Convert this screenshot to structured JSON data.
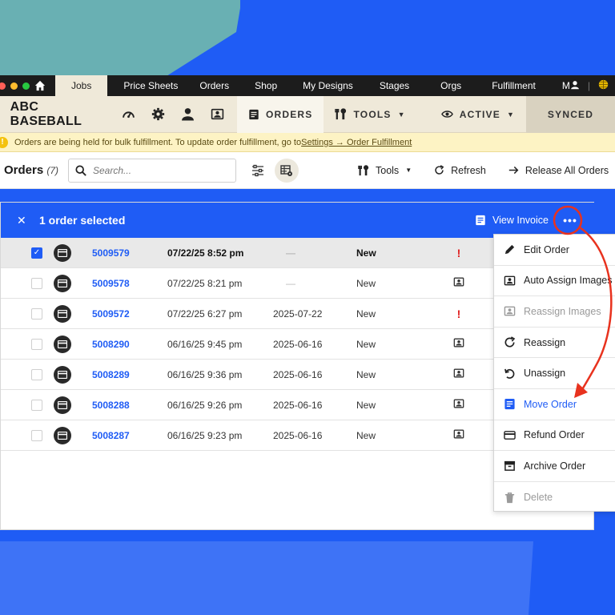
{
  "topnav": {
    "tabs": [
      "Jobs",
      "Price Sheets",
      "Orders",
      "Shop",
      "My Designs",
      "Stages",
      "Orgs",
      "Fulfillment",
      "M"
    ],
    "active_tab": "Jobs"
  },
  "orgbar": {
    "org_name": "ABC BASEBALL",
    "orders_label": "ORDERS",
    "tools_label": "TOOLS",
    "active_label": "ACTIVE",
    "synced_label": "SYNCED"
  },
  "notice": {
    "text": "Orders are being held for bulk fulfillment. To update order fulfillment, go to ",
    "link": "Settings → Order Fulfillment"
  },
  "toolbar": {
    "title": "Orders",
    "count": "(7)",
    "search_placeholder": "Search...",
    "tools_label": "Tools",
    "refresh_label": "Refresh",
    "release_label": "Release All Orders"
  },
  "selection": {
    "text": "1 order selected",
    "view_invoice": "View Invoice"
  },
  "orders": [
    {
      "number": "5009579",
      "date": "07/22/25 8:52 pm",
      "ship": "—",
      "status": "New",
      "flag": "!",
      "checked": true
    },
    {
      "number": "5009578",
      "date": "07/22/25 8:21 pm",
      "ship": "—",
      "status": "New",
      "flag": "img",
      "checked": false
    },
    {
      "number": "5009572",
      "date": "07/22/25 6:27 pm",
      "ship": "2025-07-22",
      "status": "New",
      "flag": "!",
      "checked": false
    },
    {
      "number": "5008290",
      "date": "06/16/25 9:45 pm",
      "ship": "2025-06-16",
      "status": "New",
      "flag": "img",
      "checked": false
    },
    {
      "number": "5008289",
      "date": "06/16/25 9:36 pm",
      "ship": "2025-06-16",
      "status": "New",
      "flag": "img",
      "checked": false
    },
    {
      "number": "5008288",
      "date": "06/16/25 9:26 pm",
      "ship": "2025-06-16",
      "status": "New",
      "flag": "img",
      "checked": false
    },
    {
      "number": "5008287",
      "date": "06/16/25 9:23 pm",
      "ship": "2025-06-16",
      "status": "New",
      "flag": "img",
      "checked": false
    }
  ],
  "menu": {
    "edit_order": "Edit Order",
    "auto_assign": "Auto Assign Images",
    "reassign_images": "Reassign Images",
    "reassign": "Reassign",
    "unassign": "Unassign",
    "move_order": "Move Order",
    "refund_order": "Refund Order",
    "archive_order": "Archive Order",
    "delete": "Delete"
  },
  "colors": {
    "accent": "#1f5cf5",
    "annotation": "#e8321e",
    "warning": "#fdf3c4"
  }
}
